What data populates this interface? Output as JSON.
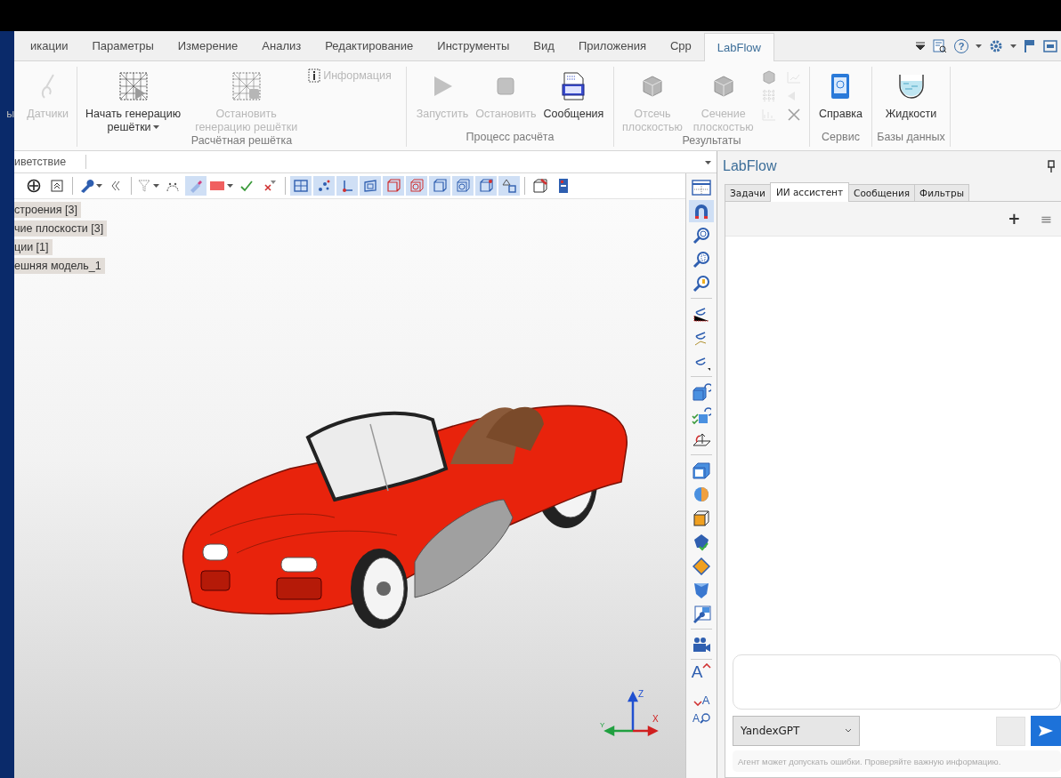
{
  "ribbon_tabs": [
    {
      "label": "икации",
      "selected": false
    },
    {
      "label": "Параметры",
      "selected": false
    },
    {
      "label": "Измерение",
      "selected": false
    },
    {
      "label": "Анализ",
      "selected": false
    },
    {
      "label": "Редактирование",
      "selected": false
    },
    {
      "label": "Инструменты",
      "selected": false
    },
    {
      "label": "Вид",
      "selected": false
    },
    {
      "label": "Приложения",
      "selected": false
    },
    {
      "label": "Срр",
      "selected": false
    },
    {
      "label": "LabFlow",
      "selected": true
    }
  ],
  "help_button": "?",
  "ribbon_groups": [
    {
      "items": [
        {
          "kind": "large",
          "lines": [
            "ы"
          ],
          "disabled": true
        },
        {
          "kind": "large",
          "lines": [
            "Датчики"
          ],
          "disabled": true
        }
      ]
    },
    {
      "title": "Расчётная решётка",
      "items": [
        {
          "kind": "large",
          "lines": [
            "Начать генерацию",
            "решётки"
          ],
          "dropdown": true,
          "disabled": false
        },
        {
          "kind": "large",
          "lines": [
            "Остановить",
            "генерацию решётки"
          ],
          "disabled": true
        },
        {
          "kind": "small",
          "lines": [
            "Информация"
          ],
          "disabled": true
        }
      ]
    },
    {
      "title": "Процесс расчёта",
      "items": [
        {
          "kind": "large",
          "lines": [
            "Запустить"
          ],
          "disabled": true
        },
        {
          "kind": "large",
          "lines": [
            "Остановить"
          ],
          "disabled": true
        },
        {
          "kind": "large",
          "lines": [
            "Сообщения"
          ],
          "disabled": false
        }
      ]
    },
    {
      "title": "Результаты",
      "items": [
        {
          "kind": "large",
          "lines": [
            "Отсечь",
            "плоскостью"
          ],
          "disabled": true
        },
        {
          "kind": "large",
          "lines": [
            "Сечение",
            "плоскостью"
          ],
          "disabled": true
        },
        {
          "kind": "icon-grid",
          "disabled": true
        }
      ]
    },
    {
      "title": "Сервис",
      "items": [
        {
          "kind": "large",
          "lines": [
            "Справка"
          ],
          "disabled": false
        }
      ]
    },
    {
      "title": "Базы данных",
      "items": [
        {
          "kind": "large",
          "lines": [
            "Жидкости"
          ],
          "disabled": false
        }
      ]
    }
  ],
  "command_field": {
    "value": "иветствие"
  },
  "view_toolbar": [
    {
      "pressed": false,
      "dropdown": false
    },
    {
      "pressed": false,
      "dropdown": false
    },
    {
      "pressed": false,
      "dropdown": true
    },
    {
      "pressed": false,
      "dropdown": false
    },
    {
      "pressed": false,
      "dropdown": true
    },
    {
      "pressed": false,
      "dropdown": false
    },
    {
      "pressed": true,
      "dropdown": false
    },
    {
      "pressed": false,
      "dropdown": true
    },
    {
      "pressed": false,
      "dropdown": false
    },
    {
      "pressed": false,
      "dropdown": false
    },
    {
      "pressed": true,
      "dropdown": false
    },
    {
      "pressed": true,
      "dropdown": false
    },
    {
      "pressed": true,
      "dropdown": false
    },
    {
      "pressed": true,
      "dropdown": false
    },
    {
      "pressed": true,
      "dropdown": false
    },
    {
      "pressed": true,
      "dropdown": false
    },
    {
      "pressed": true,
      "dropdown": false
    },
    {
      "pressed": true,
      "dropdown": false
    },
    {
      "pressed": true,
      "dropdown": false
    },
    {
      "pressed": true,
      "dropdown": false
    },
    {
      "pressed": false,
      "dropdown": false
    },
    {
      "pressed": false,
      "dropdown": false
    }
  ],
  "tree": [
    {
      "label": "строения [3]"
    },
    {
      "label": "чие плоскости [3]"
    },
    {
      "label": "ции [1]"
    },
    {
      "label": "ешняя модель_1"
    }
  ],
  "axes": {
    "z": "Z",
    "x": "X",
    "y": "Y"
  },
  "side_toolbar": [
    {
      "pressed": false
    },
    {
      "pressed": true
    },
    {
      "pressed": false
    },
    {
      "pressed": false
    },
    {
      "pressed": false
    },
    {
      "pressed": false
    },
    {
      "pressed": false
    },
    {
      "pressed": false
    },
    {
      "pressed": false
    },
    {
      "pressed": false
    },
    {
      "pressed": false
    },
    {
      "pressed": false
    },
    {
      "pressed": false
    },
    {
      "pressed": false
    },
    {
      "pressed": false
    },
    {
      "pressed": false
    },
    {
      "pressed": false
    },
    {
      "pressed": false
    },
    {
      "pressed": false
    },
    {
      "pressed": false,
      "glyph": "A"
    },
    {
      "pressed": false,
      "glyph": "A"
    },
    {
      "pressed": false,
      "glyph": "A"
    }
  ],
  "panel": {
    "title": "LabFlow",
    "tabs": [
      {
        "label": "Задачи",
        "selected": false
      },
      {
        "label": "ИИ ассистент",
        "selected": true
      },
      {
        "label": "Сообщения",
        "selected": false
      },
      {
        "label": "Фильтры",
        "selected": false
      }
    ],
    "new_chat": "+",
    "menu": "≡",
    "model": {
      "value": "YandexGPT"
    },
    "disclaimer": "Агент может допускать ошибки. Проверяйте важную информацию."
  }
}
